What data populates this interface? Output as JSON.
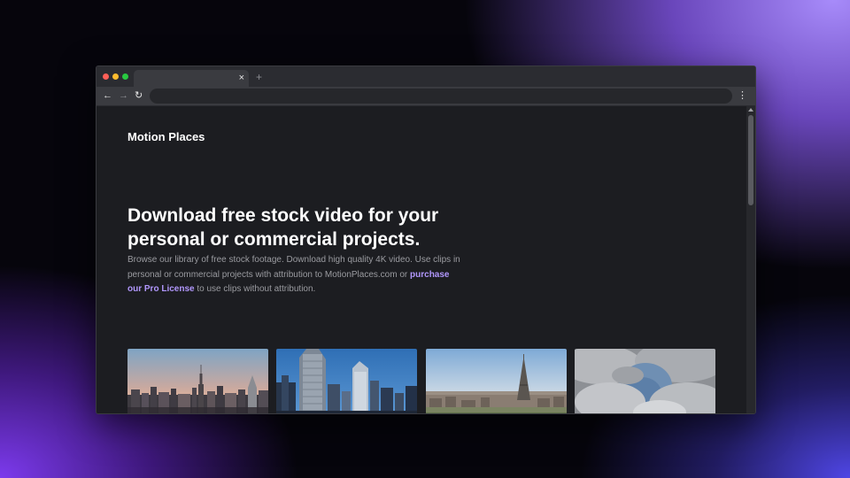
{
  "browser": {
    "tab_close": "×",
    "new_tab": "+",
    "back": "←",
    "forward": "→",
    "reload": "↻",
    "menu": "⋮"
  },
  "site": {
    "brand": "Motion Places",
    "headline": "Download free stock video for your personal or commercial projects.",
    "description_before": "Browse our library of free stock footage. Download high quality 4K video. Use clips in personal or commercial projects with attribution to MotionPlaces.com or ",
    "pro_link": "purchase our Pro License",
    "description_after": " to use clips without attribution.",
    "accent_color": "#b197fc"
  },
  "thumbnails": [
    {
      "subject": "new-york-skyline"
    },
    {
      "subject": "skyscrapers-blue-sky"
    },
    {
      "subject": "paris-eiffel-tower"
    },
    {
      "subject": "clouds"
    }
  ]
}
